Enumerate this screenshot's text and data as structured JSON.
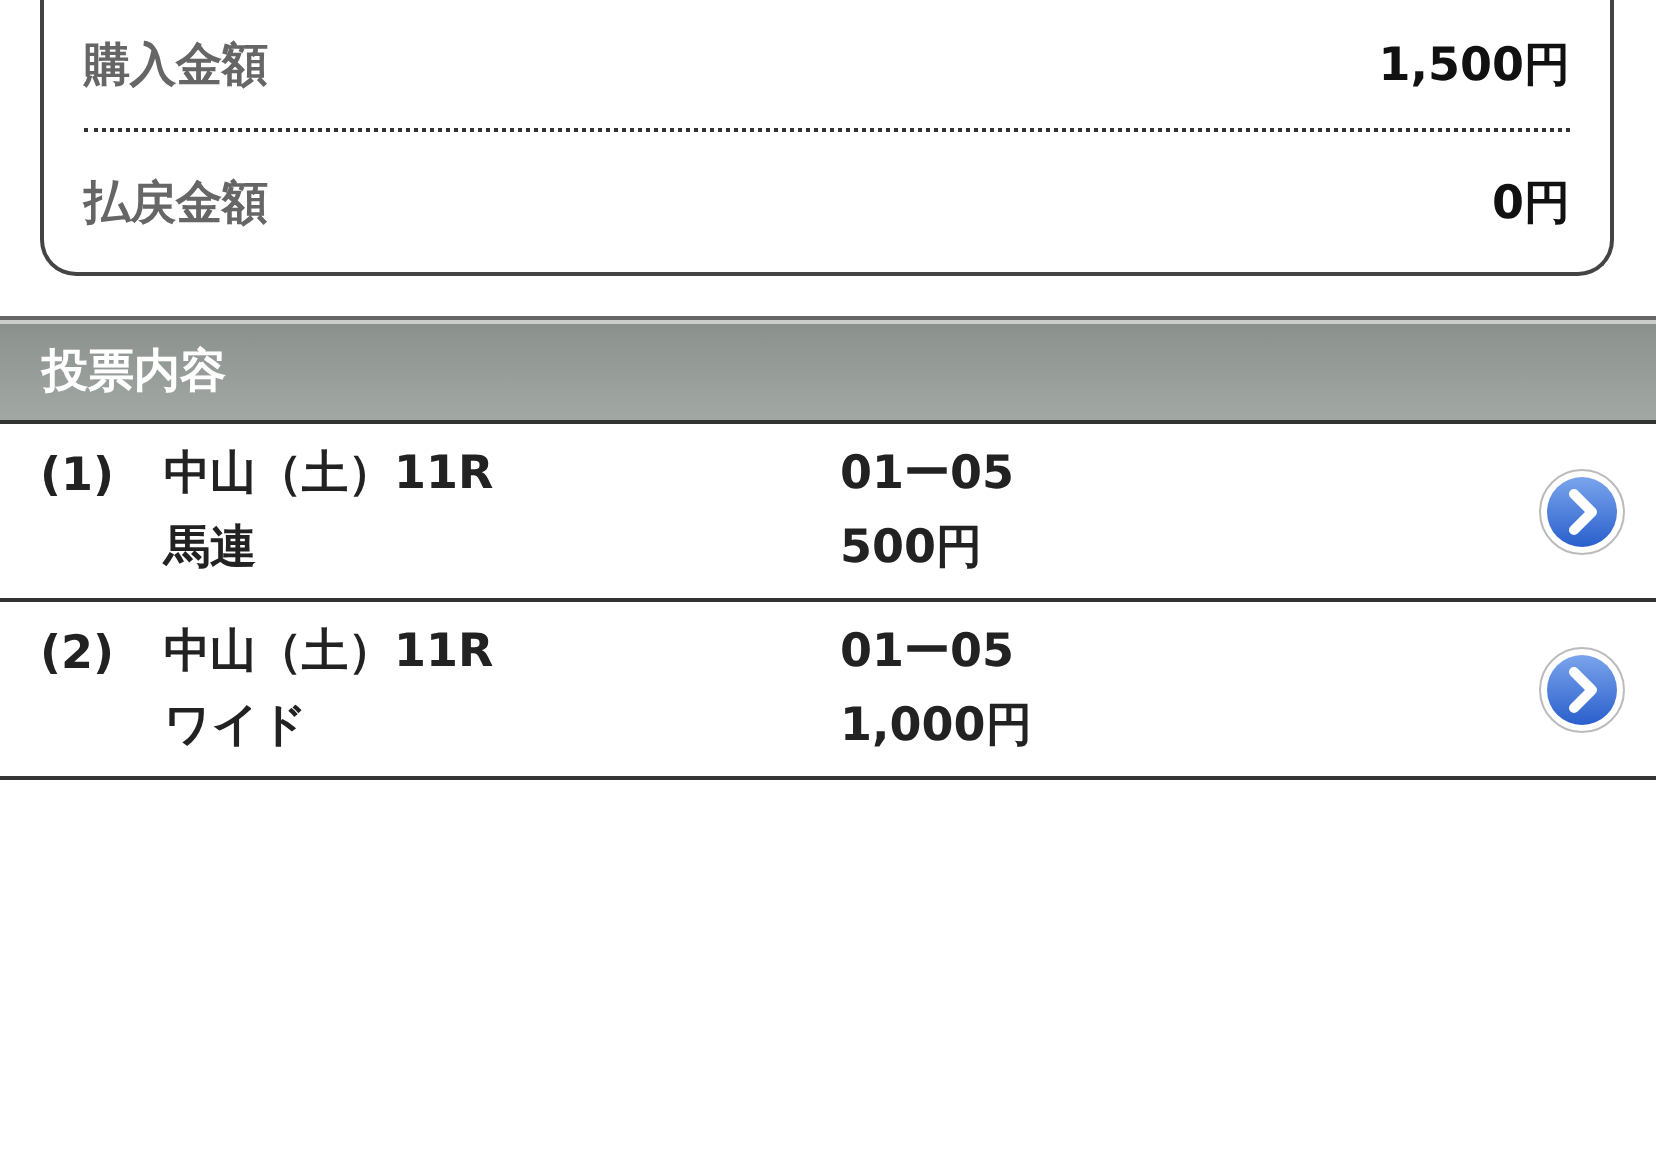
{
  "summary": {
    "rows": [
      {
        "label": "購入金額",
        "value": "1,500円"
      },
      {
        "label": "払戻金額",
        "value": "0円"
      }
    ]
  },
  "section": {
    "title": "投票内容"
  },
  "bets": [
    {
      "number": "(1)",
      "race": "中山（土）11R",
      "type": "馬連",
      "combination": "01ー05",
      "amount": "500円"
    },
    {
      "number": "(2)",
      "race": "中山（土）11R",
      "type": "ワイド",
      "combination": "01ー05",
      "amount": "1,000円"
    }
  ]
}
